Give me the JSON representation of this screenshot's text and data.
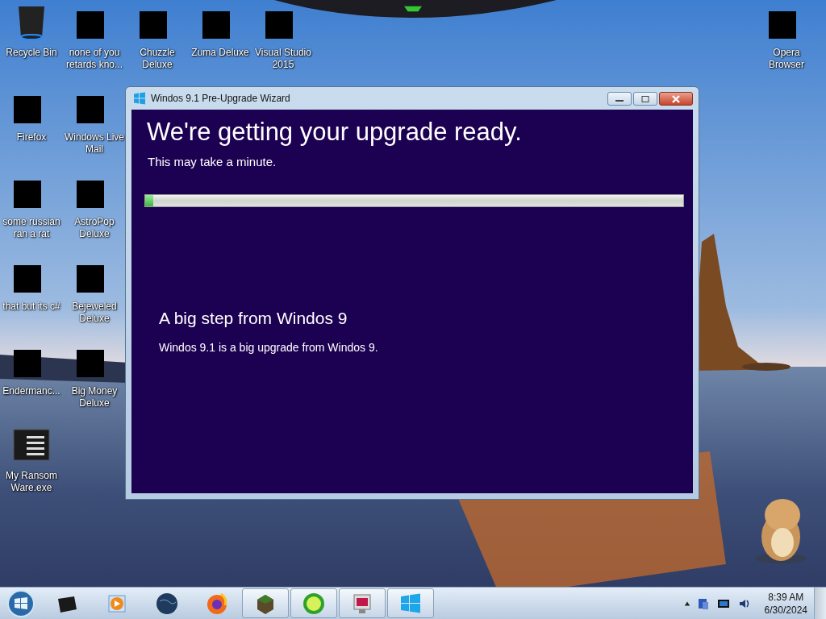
{
  "desktop_columns": [
    [
      {
        "label": "Recycle Bin",
        "kind": "bin"
      },
      {
        "label": "Firefox",
        "kind": "covered"
      },
      {
        "label": "some russian ran a rat",
        "kind": "covered"
      },
      {
        "label": "that but its c#",
        "kind": "covered"
      },
      {
        "label": "Endermanc...",
        "kind": "covered"
      },
      {
        "label": "My Ransom Ware.exe",
        "kind": "console"
      }
    ],
    [
      {
        "label": "none of you retards kno...",
        "kind": "covered"
      },
      {
        "label": "Windows Live Mail",
        "kind": "covered"
      },
      {
        "label": "AstroPop Deluxe",
        "kind": "covered"
      },
      {
        "label": "Bejeweled Deluxe",
        "kind": "covered"
      },
      {
        "label": "Big Money Deluxe",
        "kind": "covered"
      }
    ],
    [
      {
        "label": "Chuzzle Deluxe",
        "kind": "covered"
      }
    ],
    [
      {
        "label": "Zuma Deluxe",
        "kind": "covered"
      }
    ],
    [
      {
        "label": "Visual Studio 2015",
        "kind": "covered"
      }
    ]
  ],
  "right_icon": {
    "label": "Opera Browser",
    "kind": "covered"
  },
  "window": {
    "title": "Windos 9.1 Pre-Upgrade Wizard",
    "heading": "We're getting your upgrade ready.",
    "subheading": "This may take a minute.",
    "progress": {
      "level": 0.015
    },
    "step_title": "A big step from Windos 9",
    "step_text": "Windos 9.1 is a big upgrade from Windos 9."
  },
  "taskbar": {
    "pinned": [
      {
        "kind": "box"
      },
      {
        "kind": "media"
      },
      {
        "kind": "globe"
      },
      {
        "kind": "firefox"
      }
    ],
    "running": [
      {
        "kind": "block"
      },
      {
        "kind": "lime"
      },
      {
        "kind": "screen"
      },
      {
        "kind": "windows"
      }
    ],
    "clock": {
      "time": "8:39 AM",
      "date": "6/30/2024"
    }
  }
}
